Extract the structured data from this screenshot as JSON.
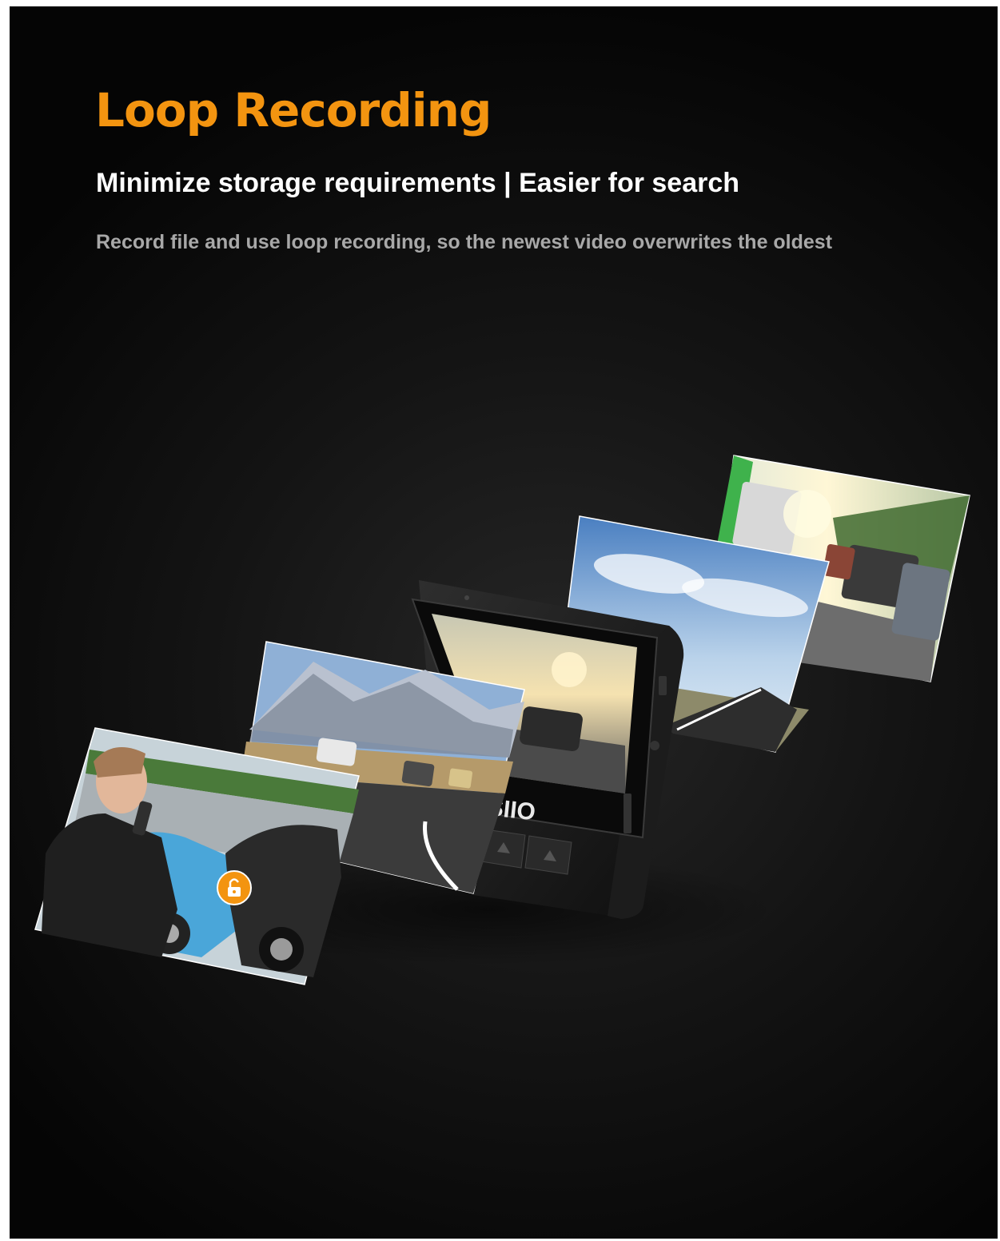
{
  "title": "Loop Recording",
  "subtitle": "Minimize storage requirements | Easier for search",
  "description": "Record file and use loop recording, so the newest video overwrites the oldest",
  "device_brand_text": "SIIO",
  "colors": {
    "accent": "#f39410",
    "background": "#0d0d0d",
    "subtitle": "#ffffff",
    "description": "#a8a8a8"
  },
  "icons": [
    "lock-icon"
  ]
}
